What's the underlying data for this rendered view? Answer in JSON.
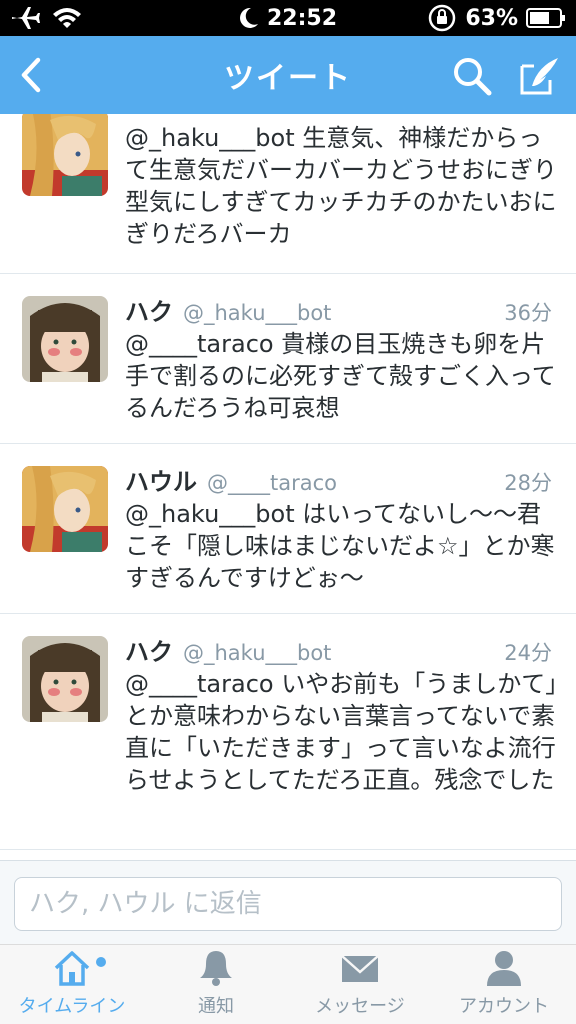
{
  "status_bar": {
    "time": "22:52",
    "battery": "63%"
  },
  "nav": {
    "title": "ツイート"
  },
  "tweets": [
    {
      "text": "@_haku___bot 生意気、神様だからって生意気だバーカバーカどうせおにぎり型気にしすぎてカッチカチのかたいおにぎりだろバーカ"
    },
    {
      "name": "ハク",
      "handle": "@_haku___bot",
      "time": "36分",
      "text": "@____taraco 貴様の目玉焼きも卵を片手で割るのに必死すぎて殻すごく入ってるんだろうね可哀想"
    },
    {
      "name": "ハウル",
      "handle": "@____taraco",
      "time": "28分",
      "text": "@_haku___bot はいってないし〜〜君こそ「隠し味はまじないだよ☆」とか寒すぎるんですけどぉ〜"
    },
    {
      "name": "ハク",
      "handle": "@_haku___bot",
      "time": "24分",
      "text": "@____taraco いやお前も「うましかて」とか意味わからない言葉言ってないで素直に「いただきます」って言いなよ流行らせようとしてただろ正直。残念でした"
    }
  ],
  "reply": {
    "placeholder": "ハク, ハウル に返信"
  },
  "tabs": [
    {
      "label": "タイムライン",
      "icon": "home-icon",
      "active": true
    },
    {
      "label": "通知",
      "icon": "bell-icon",
      "active": false
    },
    {
      "label": "メッセージ",
      "icon": "envelope-icon",
      "active": false
    },
    {
      "label": "アカウント",
      "icon": "person-icon",
      "active": false
    }
  ],
  "colors": {
    "accent": "#55acee",
    "text": "#292f33",
    "muted": "#8899a6"
  }
}
